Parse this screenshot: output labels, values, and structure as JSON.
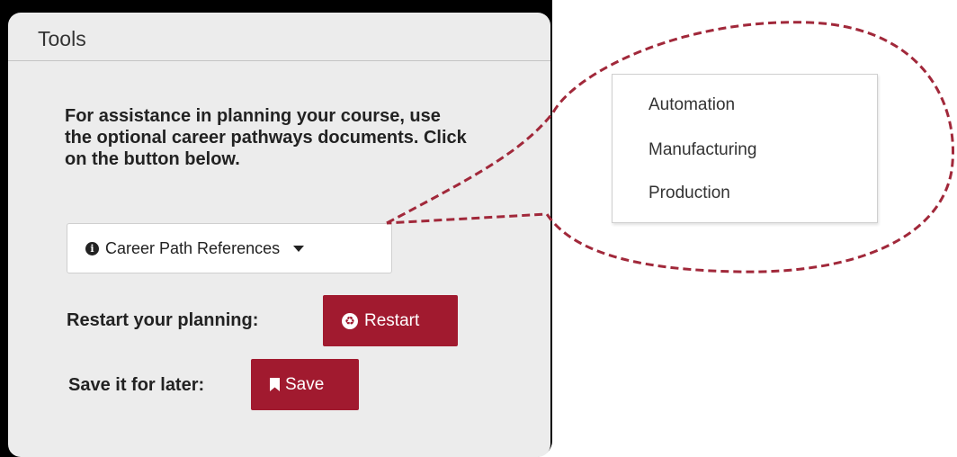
{
  "panel": {
    "title": "Tools",
    "intro": "For assistance in planning your course, use the optional career pathways documents. Click on the button below."
  },
  "dropdown": {
    "label": "Career Path References",
    "icon": "info-circle-icon",
    "menu_items": [
      "Automation",
      "Manufacturing",
      "Production"
    ]
  },
  "restart_row": {
    "label": "Restart your planning:",
    "button_label": "Restart",
    "icon": "recycle-icon"
  },
  "save_row": {
    "label": "Save it for later:",
    "button_label": "Save",
    "icon": "bookmark-icon"
  },
  "colors": {
    "accent": "#a11a2f",
    "callout_outline": "#a1283a",
    "panel_bg": "#ececec",
    "frame": "#000000"
  }
}
